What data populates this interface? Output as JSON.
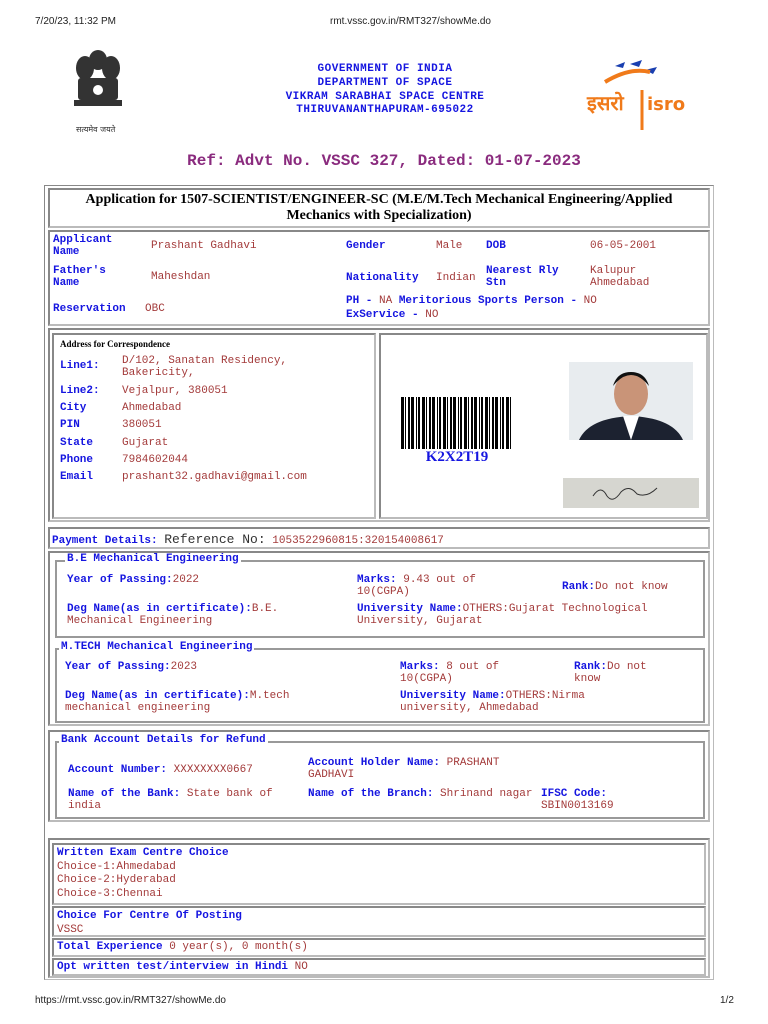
{
  "browser": {
    "datetime": "7/20/23, 11:32 PM",
    "url_top": "rmt.vssc.gov.in/RMT327/showMe.do",
    "url_bottom": "https://rmt.vssc.gov.in/RMT327/showMe.do",
    "page": "1/2"
  },
  "header": {
    "lines": [
      "GOVERNMENT OF INDIA",
      "DEPARTMENT OF SPACE",
      "VIKRAM SARABHAI SPACE CENTRE",
      "THIRUVANANTHAPURAM-695022"
    ],
    "emblem_text": "सत्यमेव जयते",
    "logo_text": "इसरो isro"
  },
  "ref": "Ref: Advt No. VSSC 327, Dated: 01-07-2023",
  "title": "Application for 1507-SCIENTIST/ENGINEER-SC (M.E/M.Tech Mechanical Engineering/Applied Mechanics with Specialization)",
  "personal": {
    "applicant_label": "Applicant Name",
    "applicant": "Prashant Gadhavi",
    "gender_label": "Gender",
    "gender": "Male",
    "dob_label": "DOB",
    "dob": "06-05-2001",
    "father_label": "Father's Name",
    "father": "Maheshdan",
    "nationality_label": "Nationality",
    "nationality": "Indian",
    "rly_label": "Nearest Rly Stn",
    "rly": "Kalupur Ahmedabad",
    "reservation_label": "Reservation",
    "reservation": "OBC",
    "ph_label": "PH -",
    "ph": "NA",
    "sports_label": "Meritorious Sports Person -",
    "sports": "NO",
    "exservice_label": "ExService -",
    "exservice": "NO"
  },
  "address": {
    "heading": "Address for Correspondence",
    "rows": [
      {
        "label": "Line1:",
        "value": "D/102, Sanatan Residency, Bakericity,"
      },
      {
        "label": "Line2:",
        "value": "Vejalpur, 380051"
      },
      {
        "label": "City",
        "value": "Ahmedabad"
      },
      {
        "label": "PIN",
        "value": "380051"
      },
      {
        "label": "State",
        "value": "Gujarat"
      },
      {
        "label": "Phone",
        "value": "7984602044"
      },
      {
        "label": "Email",
        "value": "prashant32.gadhavi@gmail.com"
      }
    ]
  },
  "barcode_code": "K2X2T19",
  "payment": {
    "label": "Payment Details:",
    "ref_label": "Reference No:",
    "ref": "1053522960815:320154008617"
  },
  "education": [
    {
      "legend": "B.E Mechanical Engineering",
      "year_label": "Year of Passing:",
      "year": "2022",
      "marks_label": "Marks:",
      "marks": "9.43 out of 10(CGPA)",
      "rank_label": "Rank:",
      "rank": "Do not know",
      "deg_label": "Deg Name(as in certificate):",
      "deg": "B.E. Mechanical Engineering",
      "univ_label": "University Name:",
      "univ": "OTHERS:Gujarat Technological University, Gujarat"
    },
    {
      "legend": "M.TECH Mechanical Engineering",
      "year_label": "Year of Passing:",
      "year": "2023",
      "marks_label": "Marks:",
      "marks": "8 out of 10(CGPA)",
      "rank_label": "Rank:",
      "rank": "Do not know",
      "deg_label": "Deg Name(as in certificate):",
      "deg": "M.tech mechanical engineering",
      "univ_label": "University Name:",
      "univ": "OTHERS:Nirma university, Ahmedabad"
    }
  ],
  "bank": {
    "legend": "Bank Account Details for Refund",
    "acc_label": "Account Number:",
    "acc": "XXXXXXXX0667",
    "holder_label": "Account Holder Name:",
    "holder": "PRASHANT GADHAVI",
    "bank_label": "Name of the Bank:",
    "bank": "State bank of india",
    "branch_label": "Name of the Branch:",
    "branch": "Shrinand nagar",
    "ifsc_label": "IFSC Code:",
    "ifsc": "SBIN0013169"
  },
  "exam": {
    "heading": "Written Exam Centre Choice",
    "choices": [
      "Choice-1:Ahmedabad",
      "Choice-2:Hyderabad",
      "Choice-3:Chennai"
    ],
    "posting_label": "Choice For Centre Of Posting",
    "posting": "VSSC",
    "exp_label": "Total Experience",
    "exp": "0 year(s), 0 month(s)",
    "hindi_label": "Opt written test/interview in Hindi",
    "hindi": "NO"
  }
}
